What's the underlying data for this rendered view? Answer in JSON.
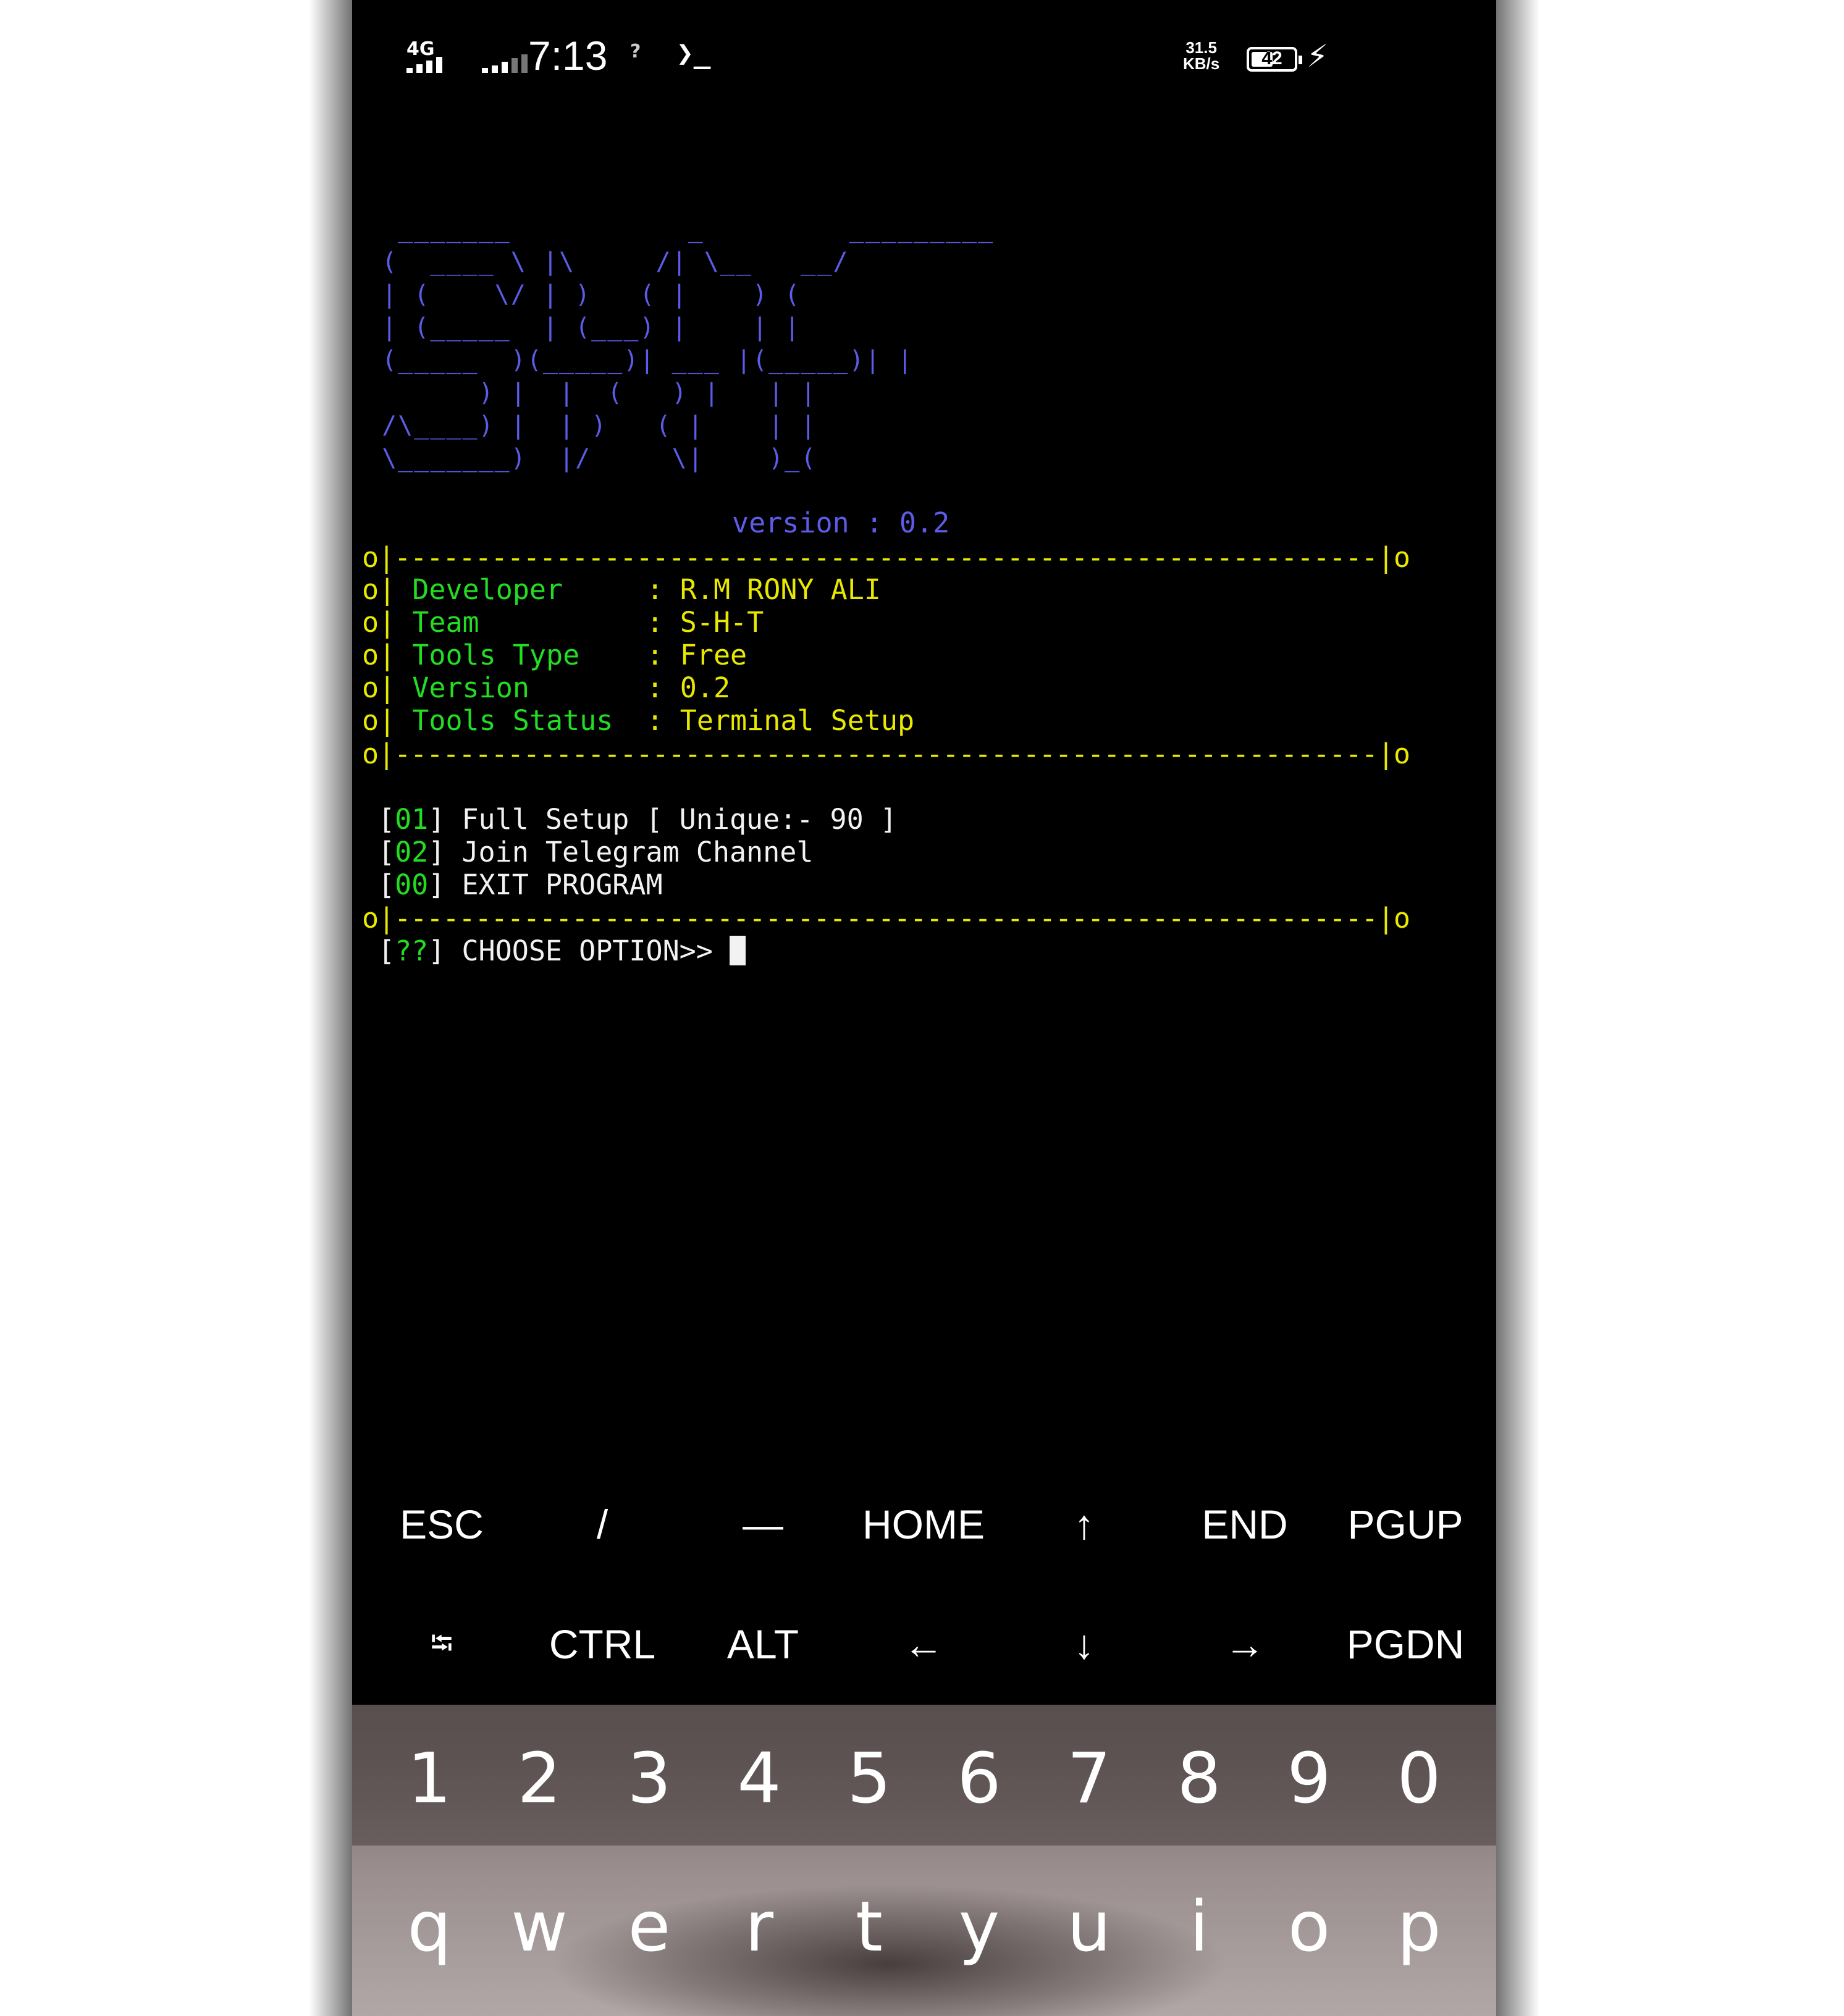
{
  "status_bar": {
    "network": "4G",
    "time": "7:13",
    "no_service": "?",
    "terminal_icon": "❯_",
    "speed_value": "31.5",
    "speed_unit": "KB/s",
    "battery": "42",
    "charging_icon": "⚡"
  },
  "terminal": {
    "ascii_logo": "  _______           _         _________\n (  ____ \\ |\\     /| \\__   __/\n | (    \\/ | )   ( |    ) (\n | (_____  | (___) |    | |\n (_____  )(_____)| ___ |(_____)| |\n       ) |  |  (   ) |   | |\n /\\____) |  | )   ( |    | |\n \\_______)  |/     \\|    )_(",
    "version_line": "version : 0.2",
    "border_left": "o|",
    "border_dashes": "-------------------------------------------------------------",
    "border_right": "|o",
    "info_rows": [
      {
        "label": "Developer   ",
        "sep": ":",
        "value": "R.M RONY ALI"
      },
      {
        "label": "Team        ",
        "sep": ":",
        "value": "S-H-T"
      },
      {
        "label": "Tools Type  ",
        "sep": ":",
        "value": "Free"
      },
      {
        "label": "Version     ",
        "sep": ":",
        "value": "0.2"
      },
      {
        "label": "Tools Status",
        "sep": ":",
        "value": "Terminal Setup"
      }
    ],
    "menu": [
      {
        "num": "01",
        "text": "Full Setup [ Unique:- 90 ]"
      },
      {
        "num": "02",
        "text": "Join Telegram Channel"
      },
      {
        "num": "00",
        "text": "EXIT PROGRAM"
      }
    ],
    "prompt_marker": "??",
    "prompt_text": "CHOOSE OPTION>>"
  },
  "extra_keys": {
    "row1": [
      "ESC",
      "/",
      "—",
      "HOME",
      "↑",
      "END",
      "PGUP"
    ],
    "row2": [
      "⭾",
      "CTRL",
      "ALT",
      "←",
      "↓",
      "→",
      "PGDN"
    ]
  },
  "keyboard": {
    "number_row": [
      "1",
      "2",
      "3",
      "4",
      "5",
      "6",
      "7",
      "8",
      "9",
      "0"
    ],
    "letter_row": [
      "q",
      "w",
      "e",
      "r",
      "t",
      "y",
      "u",
      "i",
      "o",
      "p"
    ]
  }
}
